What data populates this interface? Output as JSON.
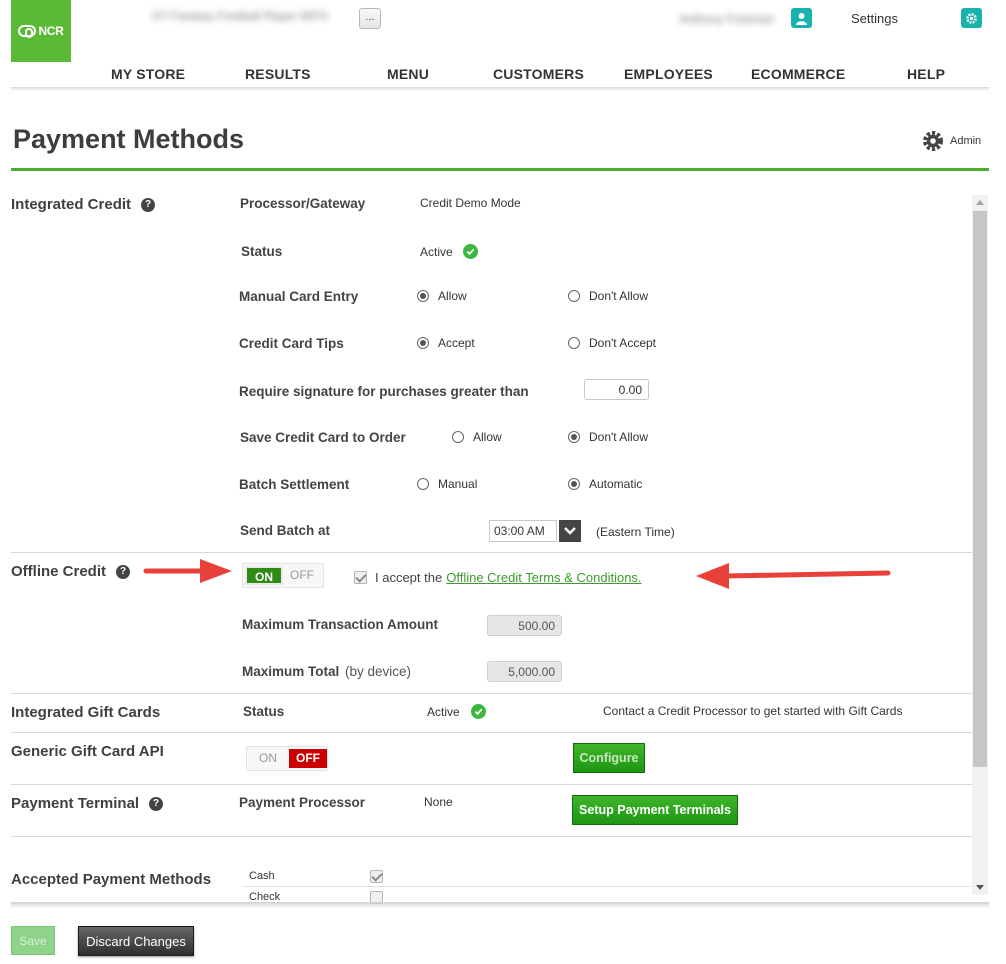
{
  "header": {
    "logo_text": "NCR",
    "store_name_blurred": "XY Fantasy Football Player 6974",
    "store_more_button": "...",
    "user_name_blurred": "Anthony Freeman",
    "user_icon": "user-icon",
    "settings_label": "Settings",
    "settings_icon": "gear-icon"
  },
  "nav": {
    "items": [
      {
        "label": "MY STORE"
      },
      {
        "label": "RESULTS"
      },
      {
        "label": "MENU"
      },
      {
        "label": "CUSTOMERS"
      },
      {
        "label": "EMPLOYEES"
      },
      {
        "label": "ECOMMERCE"
      },
      {
        "label": "HELP"
      }
    ]
  },
  "page": {
    "title": "Payment Methods",
    "admin_label": "Admin"
  },
  "integrated_credit": {
    "title": "Integrated Credit",
    "processor_label": "Processor/Gateway",
    "processor_value": "Credit Demo Mode",
    "status_label": "Status",
    "status_value": "Active",
    "manual_entry_label": "Manual Card Entry",
    "manual_entry_options": [
      "Allow",
      "Don't Allow"
    ],
    "manual_entry_selected": "Allow",
    "tips_label": "Credit Card Tips",
    "tips_options": [
      "Accept",
      "Don't Accept"
    ],
    "tips_selected": "Accept",
    "signature_label": "Require signature for purchases greater than",
    "signature_value": "0.00",
    "save_card_label": "Save Credit Card to Order",
    "save_card_options": [
      "Allow",
      "Don't Allow"
    ],
    "save_card_selected": "Don't Allow",
    "batch_label": "Batch Settlement",
    "batch_options": [
      "Manual",
      "Automatic"
    ],
    "batch_selected": "Automatic",
    "send_batch_label": "Send Batch at",
    "send_batch_time": "03:00 AM",
    "send_batch_tz": "(Eastern Time)"
  },
  "offline_credit": {
    "title": "Offline Credit",
    "toggle_on": "ON",
    "toggle_off": "OFF",
    "state": "on",
    "terms_prefix": "I accept the",
    "terms_link": "Offline Credit Terms & Conditions.",
    "terms_accepted": true,
    "max_txn_label": "Maximum Transaction Amount",
    "max_txn_value": "500.00",
    "max_total_label": "Maximum Total",
    "max_total_suffix": "(by device)",
    "max_total_value": "5,000.00"
  },
  "gift_cards": {
    "title": "Integrated Gift Cards",
    "status_label": "Status",
    "status_value": "Active",
    "note": "Contact a Credit Processor to get started with Gift Cards"
  },
  "generic_gift_api": {
    "title": "Generic Gift Card API",
    "toggle_on": "ON",
    "toggle_off": "OFF",
    "state": "off",
    "configure_label": "Configure"
  },
  "payment_terminal": {
    "title": "Payment Terminal",
    "processor_label": "Payment Processor",
    "processor_value": "None",
    "setup_label": "Setup Payment Terminals"
  },
  "accepted_methods": {
    "title": "Accepted Payment Methods",
    "rows": [
      {
        "name": "Cash",
        "checked": true
      },
      {
        "name": "Check",
        "checked": false
      }
    ]
  },
  "footer": {
    "save_label": "Save",
    "discard_label": "Discard Changes"
  },
  "colors": {
    "brand_green": "#5ab935",
    "accent_green": "#4cae2e",
    "teal": "#1ab2ac",
    "off_red": "#cc0000",
    "annotation_arrow": "#e8403a"
  }
}
